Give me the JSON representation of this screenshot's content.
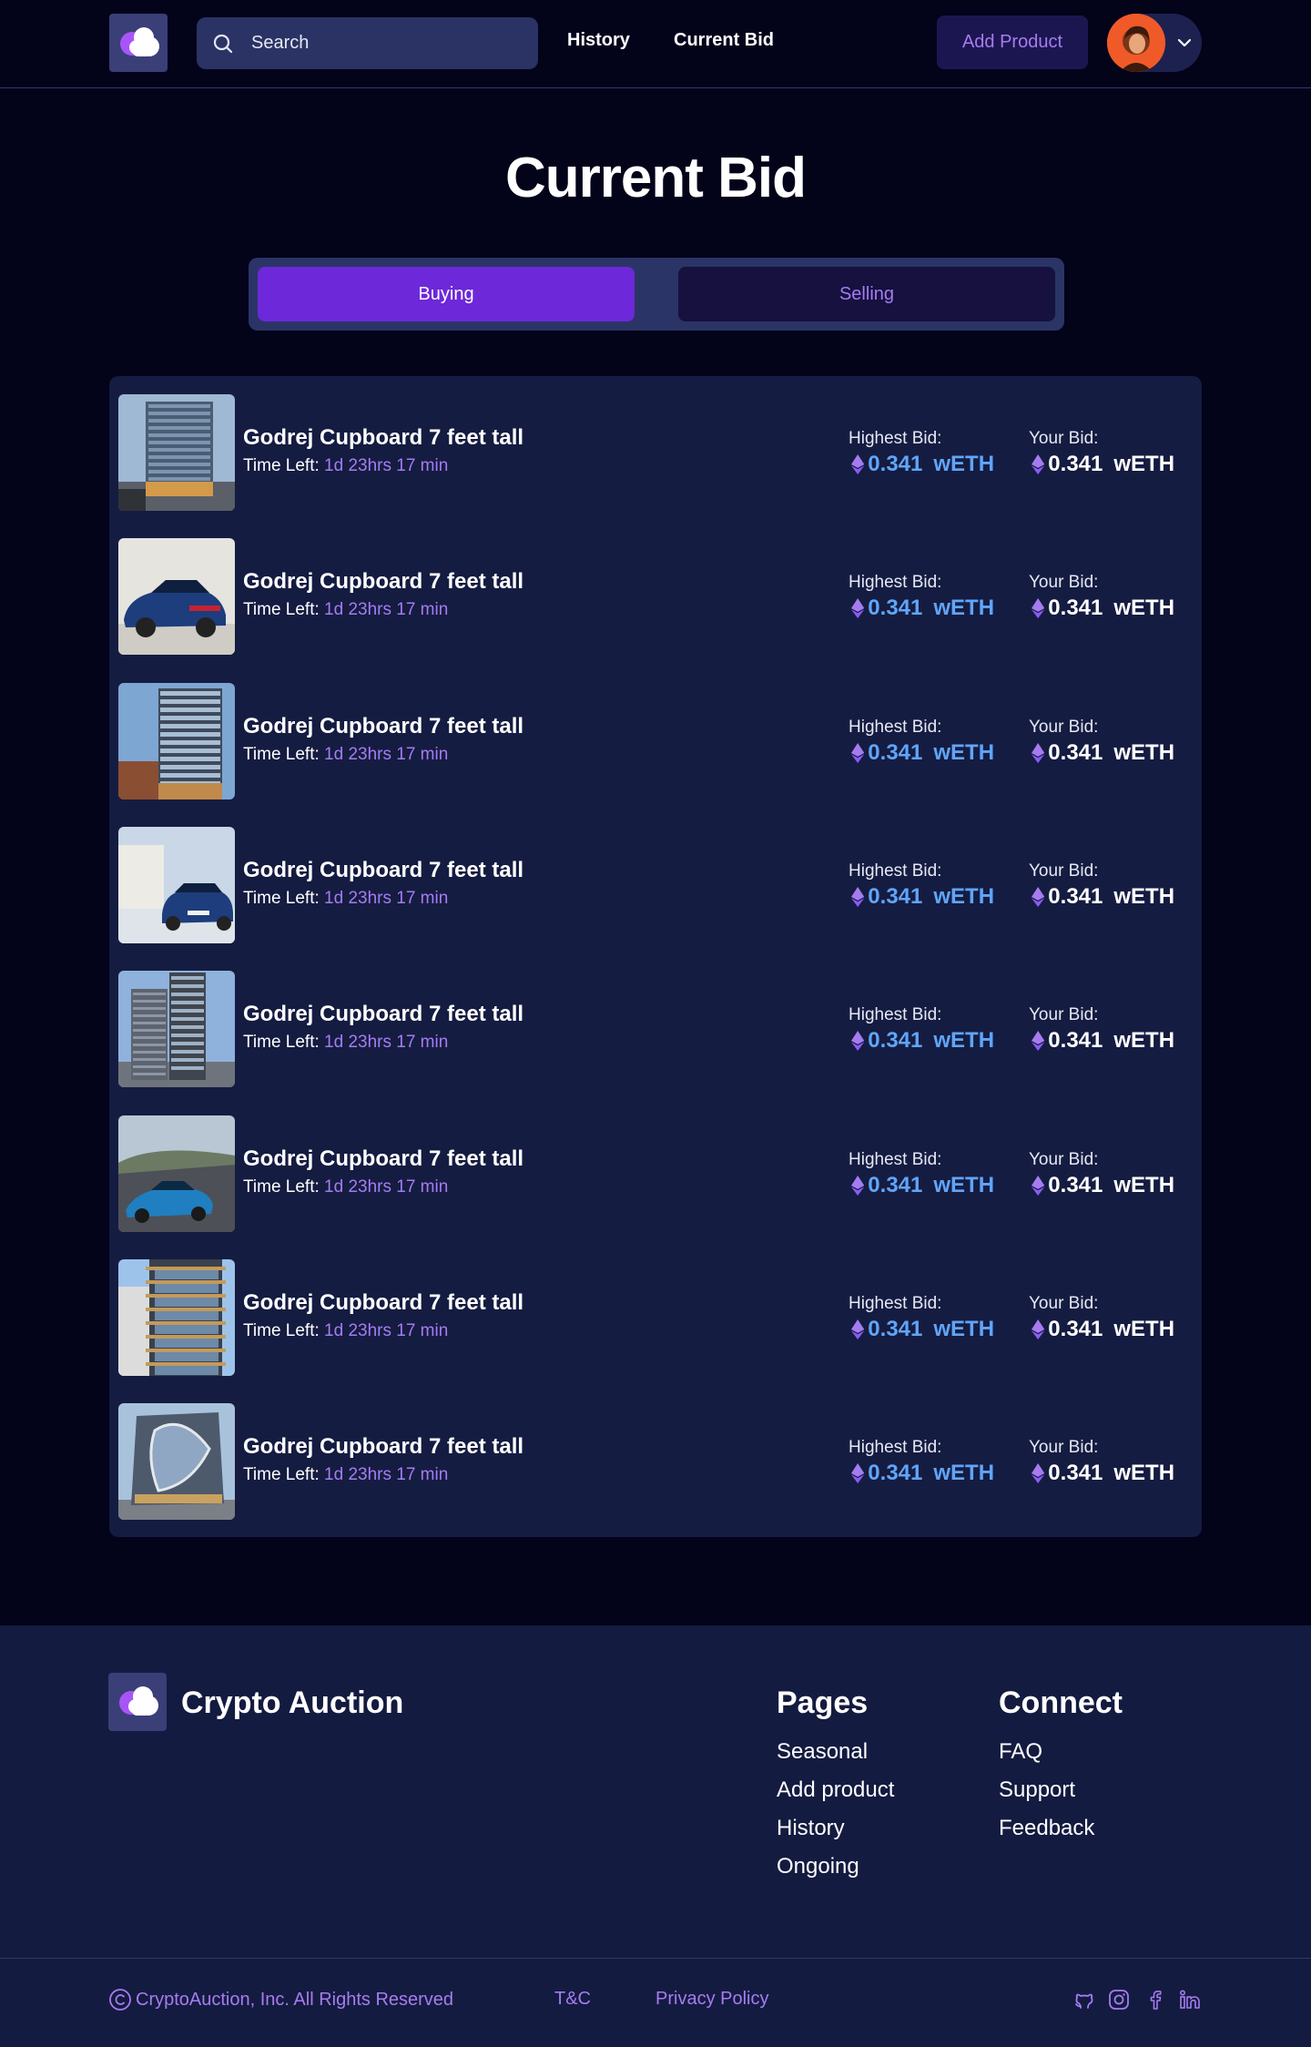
{
  "header": {
    "search_placeholder": "Search",
    "nav": {
      "history": "History",
      "current_bid": "Current Bid"
    },
    "add_product": "Add Product"
  },
  "page": {
    "title": "Current Bid",
    "tabs": {
      "buying": "Buying",
      "selling": "Selling"
    },
    "active_tab": "Buying"
  },
  "bids": [
    {
      "name": "Godrej Cupboard 7 feet tall",
      "time_label": "Time Left:",
      "time_left": "1d 23hrs 17 min",
      "highest_label": "Highest Bid:",
      "highest_value": "0.341",
      "your_label": "Your Bid:",
      "your_value": "0.341",
      "unit": "wETH",
      "image": "glass-office-building"
    },
    {
      "name": "Godrej Cupboard 7 feet tall",
      "time_label": "Time Left:",
      "time_left": "1d 23hrs 17 min",
      "highest_label": "Highest Bid:",
      "highest_value": "0.341",
      "your_label": "Your Bid:",
      "your_value": "0.341",
      "unit": "wETH",
      "image": "blue-sedan-rear"
    },
    {
      "name": "Godrej Cupboard 7 feet tall",
      "time_label": "Time Left:",
      "time_left": "1d 23hrs 17 min",
      "highest_label": "Highest Bid:",
      "highest_value": "0.341",
      "your_label": "Your Bid:",
      "your_value": "0.341",
      "unit": "wETH",
      "image": "glass-apartment-building"
    },
    {
      "name": "Godrej Cupboard 7 feet tall",
      "time_label": "Time Left:",
      "time_left": "1d 23hrs 17 min",
      "highest_label": "Highest Bid:",
      "highest_value": "0.341",
      "your_label": "Your Bid:",
      "your_value": "0.341",
      "unit": "wETH",
      "image": "blue-car-front"
    },
    {
      "name": "Godrej Cupboard 7 feet tall",
      "time_label": "Time Left:",
      "time_left": "1d 23hrs 17 min",
      "highest_label": "Highest Bid:",
      "highest_value": "0.341",
      "your_label": "Your Bid:",
      "your_value": "0.341",
      "unit": "wETH",
      "image": "residential-tower"
    },
    {
      "name": "Godrej Cupboard 7 feet tall",
      "time_label": "Time Left:",
      "time_left": "1d 23hrs 17 min",
      "highest_label": "Highest Bid:",
      "highest_value": "0.341",
      "your_label": "Your Bid:",
      "your_value": "0.341",
      "unit": "wETH",
      "image": "sports-car-road"
    },
    {
      "name": "Godrej Cupboard 7 feet tall",
      "time_label": "Time Left:",
      "time_left": "1d 23hrs 17 min",
      "highest_label": "Highest Bid:",
      "highest_value": "0.341",
      "your_label": "Your Bid:",
      "your_value": "0.341",
      "unit": "wETH",
      "image": "balcony-building"
    },
    {
      "name": "Godrej Cupboard 7 feet tall",
      "time_label": "Time Left:",
      "time_left": "1d 23hrs 17 min",
      "highest_label": "Highest Bid:",
      "highest_value": "0.341",
      "your_label": "Your Bid:",
      "your_value": "0.341",
      "unit": "wETH",
      "image": "modern-glass-office"
    }
  ],
  "footer": {
    "brand": "Crypto Auction",
    "pages_heading": "Pages",
    "pages": [
      "Seasonal",
      "Add product",
      "History",
      "Ongoing"
    ],
    "connect_heading": "Connect",
    "connect": [
      "FAQ",
      "Support",
      "Feedback"
    ],
    "copyright": "CryptoAuction, Inc. All Rights Reserved",
    "tc": "T&C",
    "privacy": "Privacy Policy",
    "social": [
      "github-icon",
      "instagram-icon",
      "facebook-icon",
      "linkedin-icon"
    ]
  },
  "colors": {
    "background": "#03031a",
    "panel": "#151c41",
    "accent": "#6d28d9",
    "accent_text": "#a57cf0",
    "highest_bid": "#60a5fa"
  }
}
